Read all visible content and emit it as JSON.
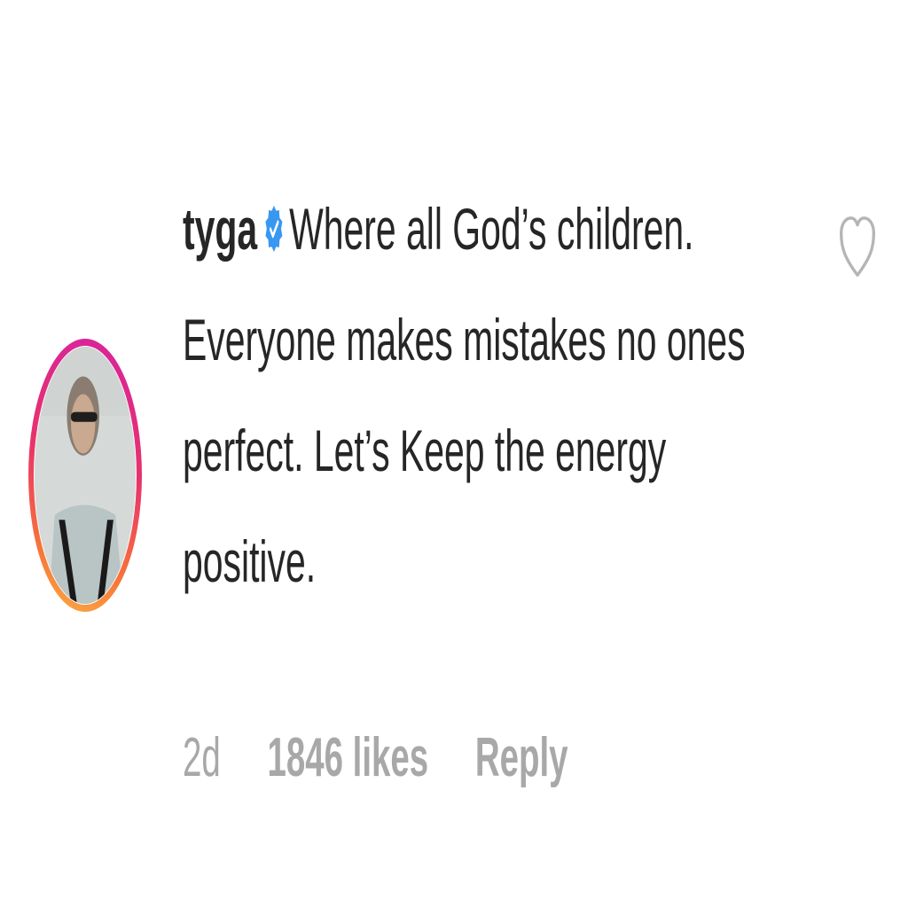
{
  "comment": {
    "username": "tyga",
    "verified": true,
    "text": "Where all God’s children. Everyone makes mistakes no ones perfect. Let’s Keep the energy positive.",
    "timestamp": "2d",
    "likes": "1846 likes",
    "reply_label": "Reply"
  },
  "colors": {
    "text": "#262626",
    "meta": "#a8a8a8",
    "verified_badge": "#3897f0",
    "story_ring": [
      "#d6249f",
      "#f77737",
      "#fcaf45"
    ]
  },
  "icons": {
    "verified": "verified-badge-icon",
    "like": "heart-outline-icon"
  }
}
